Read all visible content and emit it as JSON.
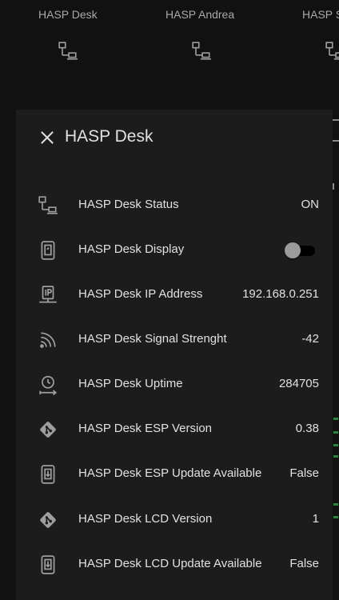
{
  "background": {
    "tiles": [
      {
        "label": "HASP Desk",
        "icon": "network-icon"
      },
      {
        "label": "HASP Andrea",
        "icon": "network-icon"
      },
      {
        "label": "HASP S",
        "icon": "network-icon"
      }
    ]
  },
  "dialog": {
    "title": "HASP Desk",
    "close_icon": "close-icon",
    "rows": [
      {
        "label": "HASP Desk Status",
        "value": "ON",
        "icon": "network-icon"
      },
      {
        "label": "HASP Desk Display",
        "type": "toggle",
        "state": "off",
        "icon": "tablet-icon"
      },
      {
        "label": "HASP Desk IP Address",
        "value": "192.168.0.251",
        "icon": "ip-network-icon"
      },
      {
        "label": "HASP Desk Signal Strenght",
        "value": "-42",
        "icon": "wifi-signal-icon"
      },
      {
        "label": "HASP Desk Uptime",
        "value": "284705",
        "icon": "clock-arrow-icon"
      },
      {
        "label": "HASP Desk ESP Version",
        "value": "0.38",
        "icon": "git-icon"
      },
      {
        "label": "HASP Desk ESP Update Available",
        "value": "False",
        "icon": "cellphone-arrow-down-icon"
      },
      {
        "label": "HASP Desk LCD Version",
        "value": "1",
        "icon": "git-icon"
      },
      {
        "label": "HASP Desk LCD Update Available",
        "value": "False",
        "icon": "cellphone-arrow-down-icon"
      }
    ]
  },
  "colors": {
    "background": "#111111",
    "dialog": "#1c1c1c",
    "text": "#e1e1e1",
    "icon": "#9e9e9e",
    "accent_green": "#1e8a3a"
  }
}
